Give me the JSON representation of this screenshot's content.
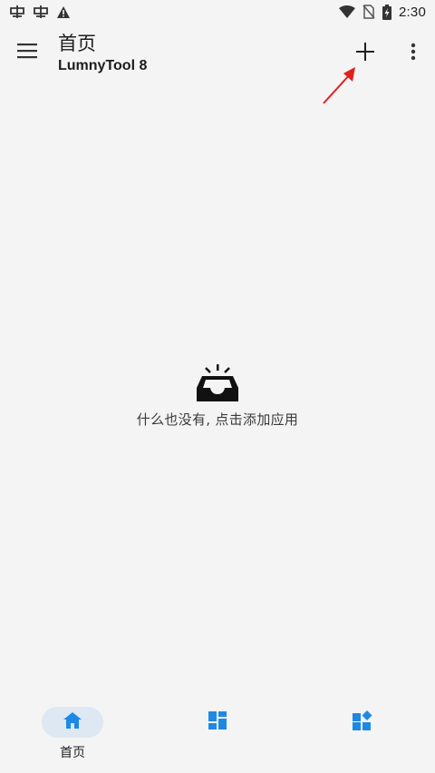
{
  "status_bar": {
    "time": "2:30",
    "left_icons": [
      "bug-icon",
      "bug-icon",
      "warning-icon"
    ],
    "right_icons": [
      "wifi-icon",
      "no-sim-icon",
      "battery-charging-icon"
    ]
  },
  "app_bar": {
    "title": "首页",
    "subtitle": "LumnyTool 8",
    "menu_icon": "menu-icon",
    "add_icon": "plus-icon",
    "more_icon": "more-vert-icon",
    "annotation_color": "#e0201c"
  },
  "empty_state": {
    "icon": "inbox-icon",
    "message": "什么也没有, 点击添加应用"
  },
  "bottom_nav": {
    "items": [
      {
        "label": "首页",
        "icon": "home-icon",
        "active": true
      },
      {
        "label": "",
        "icon": "dashboard-icon",
        "active": false
      },
      {
        "label": "",
        "icon": "widgets-icon",
        "active": false
      }
    ],
    "accent_color": "#1e88e5",
    "active_pill_color": "#dde8f3"
  }
}
